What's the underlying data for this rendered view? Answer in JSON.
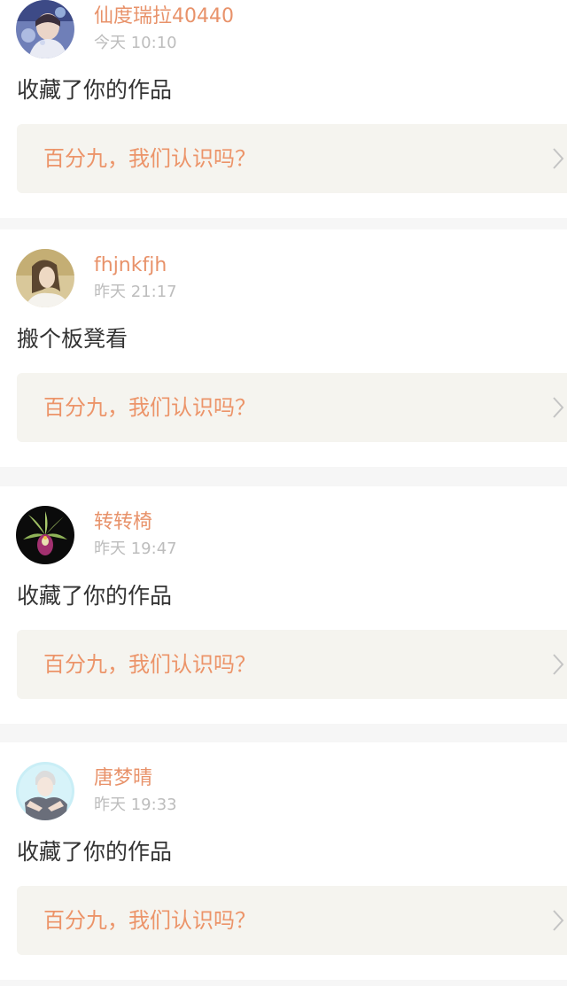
{
  "feed": [
    {
      "username": "仙度瑞拉40440",
      "time": "今天 10:10",
      "action": "收藏了你的作品",
      "work_title": "百分九，我们认识吗？",
      "avatar_icon": "avatar-portrait-icon"
    },
    {
      "username": "fhjnkfjh",
      "time": "昨天 21:17",
      "action": "搬个板凳看",
      "work_title": "百分九，我们认识吗？",
      "avatar_icon": "avatar-portrait-icon"
    },
    {
      "username": "转转椅",
      "time": "昨天 19:47",
      "action": "收藏了你的作品",
      "work_title": "百分九，我们认识吗？",
      "avatar_icon": "orchid-flower-icon"
    },
    {
      "username": "唐梦晴",
      "time": "昨天 19:33",
      "action": "收藏了你的作品",
      "work_title": "百分九，我们认识吗？",
      "avatar_icon": "avatar-illustration-icon"
    }
  ],
  "colors": {
    "username": "#e8926a",
    "work_title": "#ec9469",
    "time": "#bdbdbd",
    "action": "#333333",
    "quote_bg": "#f5f4ef",
    "separator": "#f6f6f6"
  }
}
